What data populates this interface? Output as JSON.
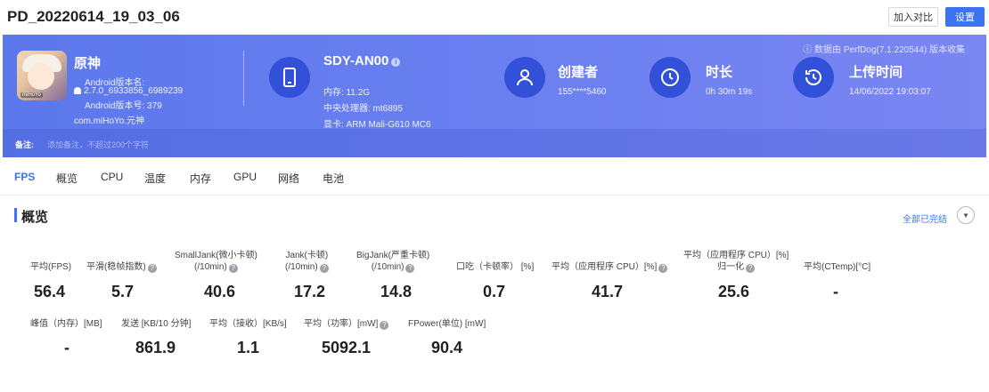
{
  "header": {
    "title": "PD_20220614_19_03_06",
    "compare_label": "加入对比",
    "settings_label": "设置"
  },
  "banner": {
    "source_note": "ⓘ 数据由 PerfDog(7.1.220544) 版本收集",
    "app": {
      "name": "原神",
      "icon_tag": "miHoYo",
      "version_name_label": "Android版本名:",
      "version_name": "2.7.0_6933856_6989239",
      "version_code": "Android版本号: 379",
      "package": "com.miHoYo.元神"
    },
    "device": {
      "name": "SDY-AN00",
      "memory": "内存: 11.2G",
      "cpu": "中央处理器: mt6895",
      "gpu": "显卡: ARM Mali-G610 MC6"
    },
    "creator": {
      "title": "创建者",
      "value": "155****5460"
    },
    "duration": {
      "title": "时长",
      "value": "0h 30m 19s"
    },
    "upload": {
      "title": "上传时间",
      "value": "14/06/2022 19:03:07"
    },
    "note_label": "备注:",
    "note_placeholder": "添加备注，不超过200个字符"
  },
  "tabs": [
    "FPS",
    "概览",
    "CPU",
    "温度",
    "内存",
    "GPU",
    "网络",
    "电池"
  ],
  "active_tab": "FPS",
  "overview": {
    "title": "概览",
    "all_done": "全部已完结"
  },
  "metrics_row1": [
    {
      "label": "平均(FPS)",
      "value": "56.4"
    },
    {
      "label": "平滑(稳帧指数)",
      "value": "5.7"
    },
    {
      "label": "SmallJank(微小卡顿)\n(/10min)",
      "value": "40.6"
    },
    {
      "label": "Jank(卡顿)\n(/10min)",
      "value": "17.2"
    },
    {
      "label": "BigJank(严重卡顿)\n(/10min)",
      "value": "14.8"
    },
    {
      "label": "口吃（卡顿率） [%]",
      "value": "0.7"
    },
    {
      "label": "平均（应用程序 CPU）[%]",
      "value": "41.7"
    },
    {
      "label": "平均（应用程序 CPU）[%]\n归一化",
      "value": "25.6"
    },
    {
      "label": "平均(CTemp)[°C]",
      "value": "-"
    }
  ],
  "metrics_row2": [
    {
      "label": "峰值（内存）[MB]",
      "value": "-"
    },
    {
      "label": "发送 [KB/10 分钟]",
      "value": "861.9"
    },
    {
      "label": "平均（接收）[KB/s]",
      "value": "1.1"
    },
    {
      "label": "平均（功率）[mW]",
      "value": "5092.1"
    },
    {
      "label": "FPower(单位) [mW]",
      "value": "90.4"
    }
  ],
  "colors": {
    "accent": "#3b73f0",
    "banner_start": "#5b78ec",
    "banner_end": "#7a86f2",
    "icon_circle": "#3350d8"
  },
  "icons": [
    "android-icon",
    "phone-icon",
    "user-icon",
    "clock-icon",
    "history-icon",
    "help-icon",
    "chevron-down-icon"
  ]
}
